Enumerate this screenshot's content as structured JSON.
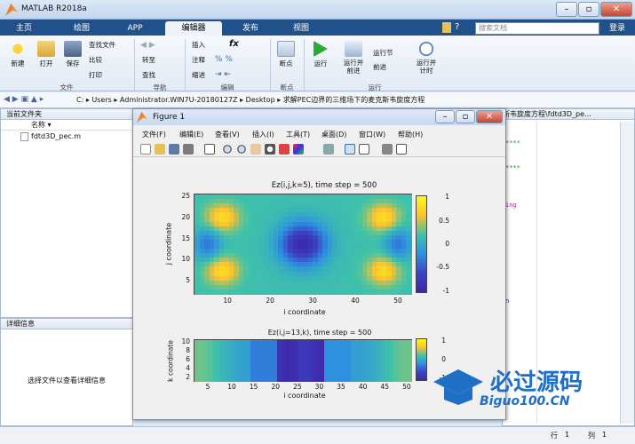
{
  "app": {
    "title": "MATLAB R2018a"
  },
  "tabs": [
    "主页",
    "绘图",
    "APP",
    "编辑器",
    "发布",
    "视图"
  ],
  "search": {
    "placeholder": "搜索文档"
  },
  "login": "登录",
  "ribbon": {
    "file": {
      "new": "新建",
      "open": "打开",
      "save": "保存",
      "find_files": "查找文件",
      "compare": "比较",
      "print": "打印",
      "group": "文件"
    },
    "nav": {
      "goto": "转至",
      "find": "查找",
      "group": "导航"
    },
    "edit": {
      "insert": "插入",
      "comment": "注释",
      "indent": "缩进",
      "group": "编辑"
    },
    "breakpoints": {
      "label": "断点",
      "group": "断点"
    },
    "run": {
      "run": "运行",
      "run_advance": "运行并\n前进",
      "run_section": "运行节",
      "advance": "前进",
      "run_time": "运行并\n计时",
      "group": "运行"
    }
  },
  "address": {
    "crumbs": [
      "C:",
      "Users",
      "Administrator.WIN7U-20180127Z",
      "Desktop",
      "求解PEC边界的三维场下的麦克斯韦旋度方程"
    ]
  },
  "current_folder": {
    "title": "当前文件夹",
    "column": "名称 ▾",
    "files": [
      "fdtd3D_pec.m"
    ]
  },
  "details": {
    "title": "详细信息",
    "hint": "选择文件以查看详细信息"
  },
  "editor": {
    "tab_title": "斯韦旋度方程\\fdtd3D_pe...",
    "code_lines": [
      "****",
      "****",
      "ing",
      "n"
    ]
  },
  "figure": {
    "title": "Figure 1",
    "menu": [
      "文件(F)",
      "编辑(E)",
      "查看(V)",
      "插入(I)",
      "工具(T)",
      "桌面(D)",
      "窗口(W)",
      "帮助(H)"
    ],
    "plot1": {
      "title": "Ez(i,j,k=5), time step = 500",
      "xlabel": "i coordinate",
      "ylabel": "j coordinate",
      "xticks": [
        "10",
        "20",
        "30",
        "40",
        "50"
      ],
      "yticks": [
        "25",
        "20",
        "15",
        "10",
        "5"
      ],
      "cticks": [
        "1",
        "0.5",
        "0",
        "-0.5",
        "-1"
      ]
    },
    "plot2": {
      "title": "Ez(i,j=13,k), time step = 500",
      "xlabel": "i coordinate",
      "ylabel": "k coordinate",
      "xticks": [
        "5",
        "10",
        "15",
        "20",
        "25",
        "30",
        "35",
        "40",
        "45",
        "50"
      ],
      "yticks": [
        "10",
        "8",
        "6",
        "4",
        "2"
      ],
      "cticks": [
        "1",
        "0",
        "-1"
      ]
    }
  },
  "status": {
    "row_label": "行",
    "row": "1",
    "col_label": "列",
    "col": "1"
  },
  "watermark": {
    "brand": "必过源码",
    "url": "Biguo100.CN"
  }
}
